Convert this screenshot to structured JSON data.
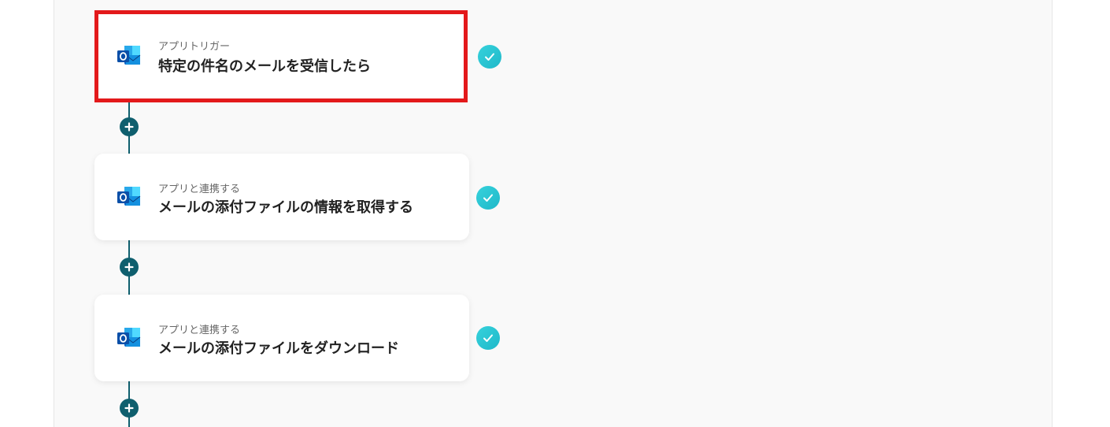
{
  "flow": {
    "steps": [
      {
        "subtitle": "アプリトリガー",
        "title": "特定の件名のメールを受信したら",
        "app_icon": "outlook-icon",
        "status": "completed",
        "selected": true
      },
      {
        "subtitle": "アプリと連携する",
        "title": "メールの添付ファイルの情報を取得する",
        "app_icon": "outlook-icon",
        "status": "completed",
        "selected": false
      },
      {
        "subtitle": "アプリと連携する",
        "title": "メールの添付ファイルをダウンロード",
        "app_icon": "outlook-icon",
        "status": "completed",
        "selected": false
      }
    ],
    "add_button_icon": "plus-icon",
    "status_icon": "check-icon"
  },
  "colors": {
    "connector": "#0f5f6e",
    "selection_border": "#e3191b",
    "check": "#27c2d0",
    "outlook_blue": "#0a64c8"
  }
}
